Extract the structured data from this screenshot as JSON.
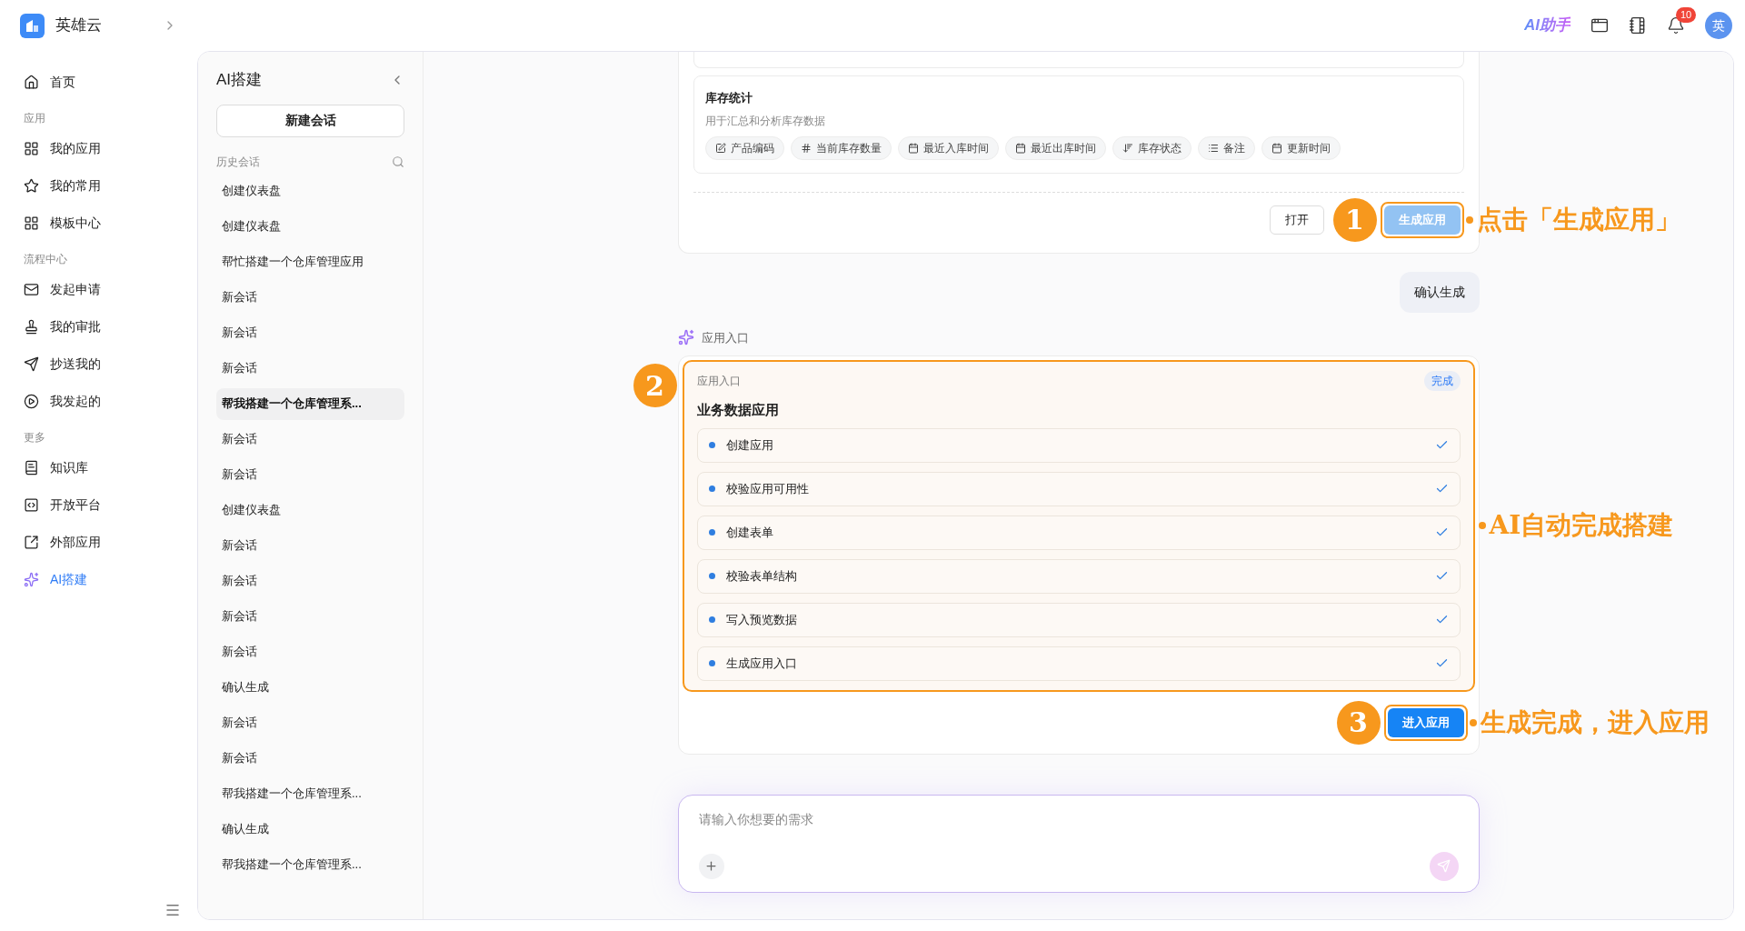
{
  "brand": {
    "name": "英雄云"
  },
  "topbar": {
    "ai_assistant": "AI助手",
    "notifications": "10",
    "avatar": "英"
  },
  "nav": {
    "top": [
      {
        "label": "首页",
        "selected": false
      }
    ],
    "sections": [
      {
        "title": "应用",
        "items": [
          {
            "label": "我的应用",
            "selected": false
          },
          {
            "label": "我的常用",
            "selected": false
          },
          {
            "label": "模板中心",
            "selected": false
          }
        ]
      },
      {
        "title": "流程中心",
        "items": [
          {
            "label": "发起申请",
            "selected": false
          },
          {
            "label": "我的审批",
            "selected": false
          },
          {
            "label": "抄送我的",
            "selected": false
          },
          {
            "label": "我发起的",
            "selected": false
          }
        ]
      },
      {
        "title": "更多",
        "items": [
          {
            "label": "知识库",
            "selected": false
          },
          {
            "label": "开放平台",
            "selected": false
          },
          {
            "label": "外部应用",
            "selected": false
          },
          {
            "label": "AI搭建",
            "selected": true
          }
        ]
      }
    ]
  },
  "history": {
    "title": "AI搭建",
    "new_button": "新建会话",
    "heading": "历史会话",
    "items": [
      {
        "label": "创建仪表盘",
        "selected": false
      },
      {
        "label": "创建仪表盘",
        "selected": false
      },
      {
        "label": "帮忙搭建一个仓库管理应用",
        "selected": false
      },
      {
        "label": "新会话",
        "selected": false
      },
      {
        "label": "新会话",
        "selected": false
      },
      {
        "label": "新会话",
        "selected": false
      },
      {
        "label": "帮我搭建一个仓库管理系...",
        "selected": true
      },
      {
        "label": "新会话",
        "selected": false
      },
      {
        "label": "新会话",
        "selected": false
      },
      {
        "label": "创建仪表盘",
        "selected": false
      },
      {
        "label": "新会话",
        "selected": false
      },
      {
        "label": "新会话",
        "selected": false
      },
      {
        "label": "新会话",
        "selected": false
      },
      {
        "label": "新会话",
        "selected": false
      },
      {
        "label": "确认生成",
        "selected": false
      },
      {
        "label": "新会话",
        "selected": false
      },
      {
        "label": "新会话",
        "selected": false
      },
      {
        "label": "帮我搭建一个仓库管理系...",
        "selected": false
      },
      {
        "label": "确认生成",
        "selected": false
      },
      {
        "label": "帮我搭建一个仓库管理系...",
        "selected": false
      }
    ]
  },
  "chat": {
    "table_card": {
      "title": "库存统计",
      "description": "用于汇总和分析库存数据",
      "fields": [
        "产品编码",
        "当前库存数量",
        "最近入库时间",
        "最近出库时间",
        "库存状态",
        "备注",
        "更新时间"
      ]
    },
    "buttons": [
      {
        "label": "打开",
        "kind": "secondary"
      },
      {
        "label": "生成应用",
        "kind": "primary",
        "disabled": true
      }
    ],
    "user_message": "确认生成",
    "agent_label": "应用入口",
    "progress": {
      "label": "应用入口",
      "badge": "完成",
      "title": "业务数据应用",
      "steps": [
        {
          "label": "创建应用",
          "done": true
        },
        {
          "label": "校验应用可用性",
          "done": true
        },
        {
          "label": "创建表单",
          "done": true
        },
        {
          "label": "校验表单结构",
          "done": true
        },
        {
          "label": "写入预览数据",
          "done": true
        },
        {
          "label": "生成应用入口",
          "done": true
        }
      ]
    },
    "enter_button": "进入应用",
    "input": {
      "placeholder": "请输入你想要的需求"
    }
  },
  "annotations": [
    {
      "number": "1",
      "text": "点击「生成应用」"
    },
    {
      "number": "2",
      "text": "AI自动完成搭建"
    },
    {
      "number": "3",
      "text": "生成完成，进入应用"
    }
  ]
}
